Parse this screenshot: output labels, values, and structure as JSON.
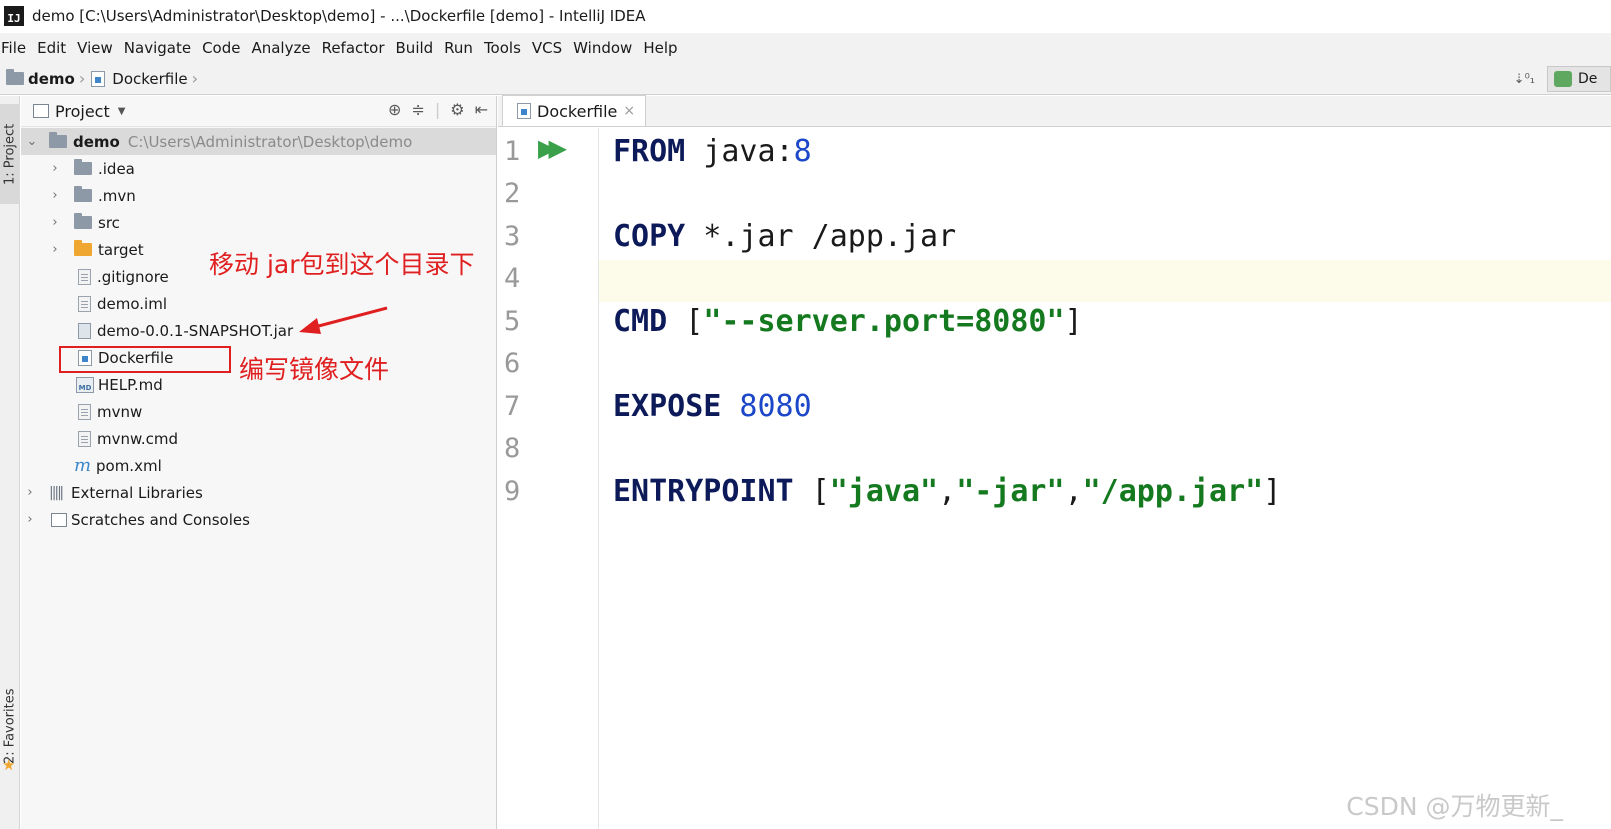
{
  "titlebar": {
    "icon": "IJ",
    "title": "demo [C:\\Users\\Administrator\\Desktop\\demo] - ...\\Dockerfile [demo] - IntelliJ IDEA"
  },
  "menu": [
    "File",
    "Edit",
    "View",
    "Navigate",
    "Code",
    "Analyze",
    "Refactor",
    "Build",
    "Run",
    "Tools",
    "VCS",
    "Window",
    "Help"
  ],
  "navbar": {
    "crumbs": [
      "demo",
      "Dockerfile"
    ],
    "run_config": "De"
  },
  "leftstrip": {
    "project_tab": "1: Project",
    "favorites_tab": "2: Favorites"
  },
  "project_panel": {
    "title": "Project",
    "root": {
      "name": "demo",
      "path": "C:\\Users\\Administrator\\Desktop\\demo"
    },
    "items": [
      {
        "label": ".idea",
        "icon": "folder-icon"
      },
      {
        "label": ".mvn",
        "icon": "folder-icon"
      },
      {
        "label": "src",
        "icon": "folder-icon"
      },
      {
        "label": "target",
        "icon": "folder-orange-icon"
      },
      {
        "label": ".gitignore",
        "icon": "text-file-icon"
      },
      {
        "label": "demo.iml",
        "icon": "iml-file-icon"
      },
      {
        "label": "demo-0.0.1-SNAPSHOT.jar",
        "icon": "jar-file-icon"
      },
      {
        "label": "Dockerfile",
        "icon": "docker-file-icon"
      },
      {
        "label": "HELP.md",
        "icon": "markdown-file-icon"
      },
      {
        "label": "mvnw",
        "icon": "text-file-icon"
      },
      {
        "label": "mvnw.cmd",
        "icon": "text-file-icon"
      },
      {
        "label": "pom.xml",
        "icon": "maven-icon"
      },
      {
        "label": "External Libraries",
        "icon": "library-icon"
      },
      {
        "label": "Scratches and Consoles",
        "icon": "scratches-icon"
      }
    ]
  },
  "annotations": {
    "move_jar": "移动 jar包到这个目录下",
    "write_image": "编写镜像文件"
  },
  "editor": {
    "tab": "Dockerfile",
    "line_numbers": [
      "1",
      "2",
      "3",
      "4",
      "5",
      "6",
      "7",
      "8",
      "9"
    ],
    "code": {
      "from_kw": "FROM",
      "from_img": " java:",
      "from_ver": "8",
      "copy_kw": "COPY",
      "copy_args": " *.jar /app.jar",
      "cmd_kw": "CMD",
      "cmd_open": " [",
      "cmd_str": "\"--server.port=8080\"",
      "cmd_close": "]",
      "expose_kw": "EXPOSE",
      "expose_port": " 8080",
      "entry_kw": "ENTRYPOINT",
      "entry_open": " [",
      "entry_s1": "\"java\"",
      "entry_c1": ",",
      "entry_s2": "\"-jar\"",
      "entry_c2": ",",
      "entry_s3": "\"/app.jar\"",
      "entry_close": "]"
    }
  },
  "watermark": "CSDN @万物更新_"
}
